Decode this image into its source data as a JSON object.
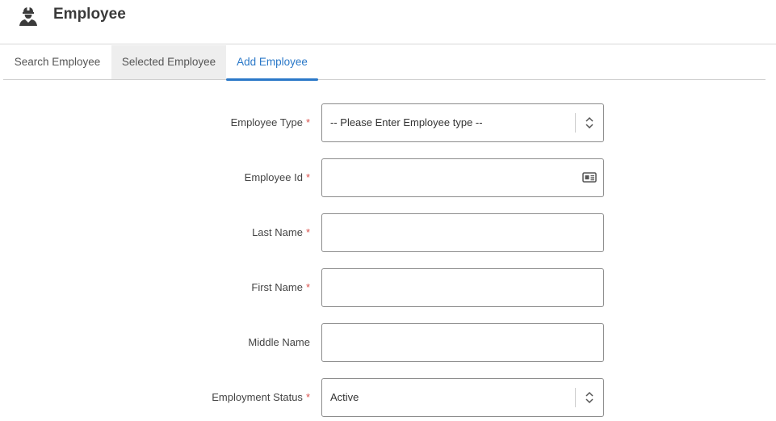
{
  "header": {
    "title": "Employee",
    "icon": "worker-icon"
  },
  "tabs": [
    {
      "label": "Search Employee",
      "active": false
    },
    {
      "label": "Selected Employee",
      "active": false
    },
    {
      "label": "Add Employee",
      "active": true
    }
  ],
  "form": {
    "required_marker": "*",
    "fields": [
      {
        "label": "Employee Type",
        "required": true,
        "type": "select",
        "value": "-- Please Enter Employee type --"
      },
      {
        "label": "Employee Id",
        "required": true,
        "type": "text",
        "value": "",
        "icon": "id-card-icon"
      },
      {
        "label": "Last Name",
        "required": true,
        "type": "text",
        "value": ""
      },
      {
        "label": "First Name",
        "required": true,
        "type": "text",
        "value": ""
      },
      {
        "label": "Middle Name",
        "required": false,
        "type": "text",
        "value": ""
      },
      {
        "label": "Employment Status",
        "required": true,
        "type": "select",
        "value": "Active"
      }
    ]
  },
  "colors": {
    "accent": "#2a78c8",
    "required": "#d9534f",
    "active_tab_bg": "#eeeeee"
  }
}
